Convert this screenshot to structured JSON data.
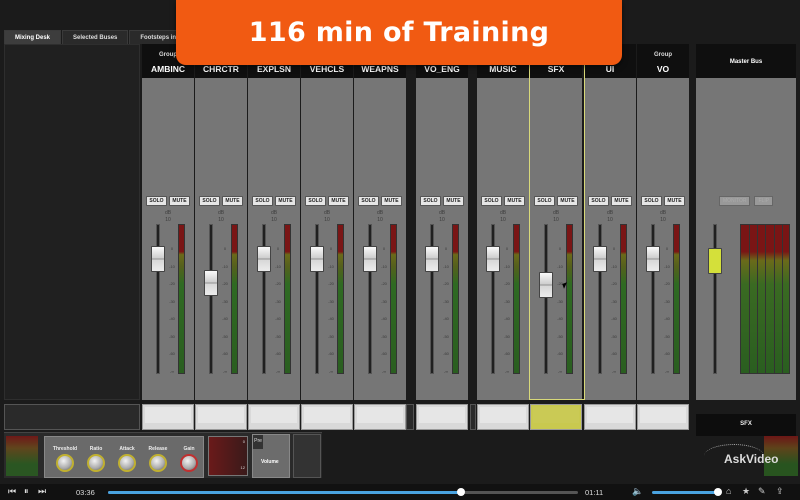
{
  "banner": {
    "text": "116 min of Training"
  },
  "tabs": [
    {
      "label": "Mixing Desk",
      "active": true
    },
    {
      "label": "Selected Buses",
      "active": false
    },
    {
      "label": "Footsteps in to",
      "active": false
    }
  ],
  "channels": [
    {
      "group": "Group",
      "name": "AMBINC",
      "fader": 0.18
    },
    {
      "group": "",
      "name": "CHRCTR",
      "fader": 0.38
    },
    {
      "group": "",
      "name": "EXPLSN",
      "fader": 0.18
    },
    {
      "group": "",
      "name": "VEHCLS",
      "fader": 0.18
    },
    {
      "group": "",
      "name": "WEAPNS",
      "fader": 0.18
    },
    {
      "group": "",
      "name": "VO_ENG",
      "fader": 0.18
    },
    {
      "group": "",
      "name": "MUSIC",
      "fader": 0.18
    },
    {
      "group": "",
      "name": "SFX",
      "fader": 0.4
    },
    {
      "group": "",
      "name": "UI",
      "fader": 0.18
    },
    {
      "group": "Group",
      "name": "VO",
      "fader": 0.18
    }
  ],
  "channel_buttons": {
    "solo": "SOLO",
    "mute": "MUTE",
    "db": "dB",
    "db_top": "10"
  },
  "scale_ticks": [
    "0",
    "-10",
    "-20",
    "-30",
    "-40",
    "-50",
    "-60",
    "-∞"
  ],
  "master": {
    "name": "Master Bus",
    "monitor": "MONITOR",
    "flip": "FLIP",
    "fader": 0.2,
    "color": "#d4e03a"
  },
  "selected_bus": {
    "name": "SFX"
  },
  "effects": {
    "knobs": [
      "Threshold",
      "Ratio",
      "Attack",
      "Release",
      "Gain"
    ],
    "gr_marks": [
      "0",
      "12"
    ],
    "pre_tag": "Pre",
    "volume": "Volume"
  },
  "logo": {
    "text": "AskVideo"
  },
  "player": {
    "elapsed": "03:36",
    "remaining": "01:11",
    "progress": 0.75,
    "volume": 1.0
  },
  "colors": {
    "banner": "#f15a12",
    "selected": "#d8d97a",
    "accent": "#4aa3e0"
  }
}
